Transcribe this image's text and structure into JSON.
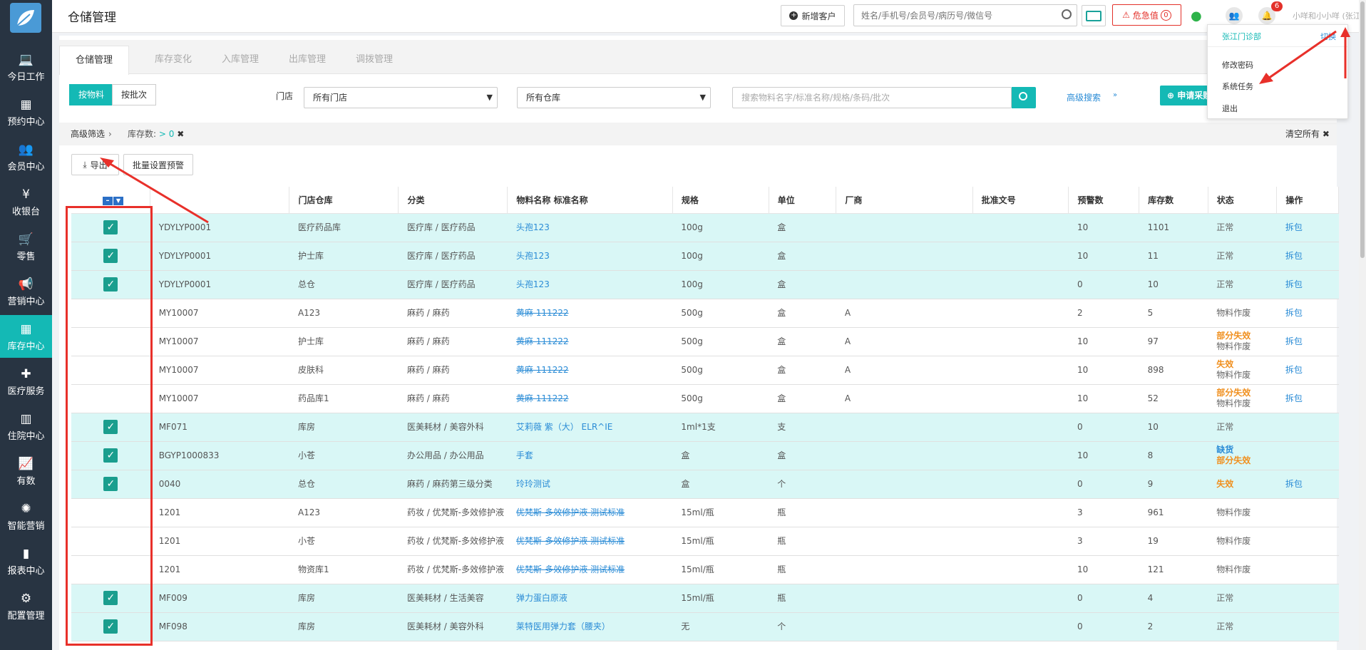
{
  "app": {
    "title": "仓储管理"
  },
  "sidebar": {
    "items": [
      {
        "label": "今日工作",
        "icon": "laptop-icon"
      },
      {
        "label": "预约中心",
        "icon": "calendar-icon"
      },
      {
        "label": "会员中心",
        "icon": "users-icon"
      },
      {
        "label": "收银台",
        "icon": "yen-icon"
      },
      {
        "label": "零售",
        "icon": "cart-icon"
      },
      {
        "label": "营销中心",
        "icon": "megaphone-icon"
      },
      {
        "label": "库存中心",
        "icon": "grid-icon"
      },
      {
        "label": "医疗服务",
        "icon": "medkit-icon"
      },
      {
        "label": "住院中心",
        "icon": "hospital-icon"
      },
      {
        "label": "有数",
        "icon": "line-chart-icon"
      },
      {
        "label": "智能营销",
        "icon": "smart-icon"
      },
      {
        "label": "报表中心",
        "icon": "bar-chart-icon"
      },
      {
        "label": "配置管理",
        "icon": "gear-icon"
      }
    ]
  },
  "header": {
    "new_customer": "新增客户",
    "search_placeholder": "姓名/手机号/会员号/病历号/微信号",
    "danger": "危急值",
    "danger_count": "0",
    "bell_badge": "6",
    "user": "小咩和小小咩 (张江门诊部)"
  },
  "dropdown": {
    "clinic": "张江门诊部",
    "switch": "切换",
    "items": [
      "修改密码",
      "系统任务",
      "退出"
    ]
  },
  "tabs": [
    "仓储管理",
    "库存变化",
    "入库管理",
    "出库管理",
    "调拨管理"
  ],
  "toolbar": {
    "by_material": "按物料",
    "by_batch": "按批次",
    "store_label": "门店",
    "store_value": "所有门店",
    "warehouse_value": "所有仓库",
    "search_placeholder": "搜索物料名字/标准名称/规格/条码/批次",
    "advanced": "高级搜索",
    "apply": "申请采购"
  },
  "filter": {
    "label": "高级筛选",
    "chip_key": "库存数:",
    "chip_val": "> 0",
    "clear": "清空所有"
  },
  "actions": {
    "export": "导出",
    "batch_alert": "批量设置预警"
  },
  "table": {
    "columns": [
      "门店仓库",
      "分类",
      "物料名称 标准名称",
      "规格",
      "单位",
      "厂商",
      "批准文号",
      "预警数",
      "库存数",
      "状态",
      "操作"
    ],
    "rows": [
      {
        "checked": true,
        "code": "YDYLYP0001",
        "wh": "医疗药品库",
        "cat": "医疗库 / 医疗药品",
        "name": "头孢123",
        "style": "link",
        "spec": "100g",
        "unit": "盒",
        "maker": "",
        "alert": "10",
        "stock": "1101",
        "status": [
          "正常"
        ],
        "status_cls": [
          "grey-s"
        ],
        "op": "拆包"
      },
      {
        "checked": true,
        "code": "YDYLYP0001",
        "wh": "护士库",
        "cat": "医疗库 / 医疗药品",
        "name": "头孢123",
        "style": "link",
        "spec": "100g",
        "unit": "盒",
        "maker": "",
        "alert": "10",
        "stock": "11",
        "status": [
          "正常"
        ],
        "status_cls": [
          "grey-s"
        ],
        "op": "拆包"
      },
      {
        "checked": true,
        "code": "YDYLYP0001",
        "wh": "总仓",
        "cat": "医疗库 / 医疗药品",
        "name": "头孢123",
        "style": "link",
        "spec": "100g",
        "unit": "盒",
        "maker": "",
        "alert": "0",
        "stock": "10",
        "status": [
          "正常"
        ],
        "status_cls": [
          "grey-s"
        ],
        "op": "拆包"
      },
      {
        "checked": false,
        "code": "MY10007",
        "wh": "A123",
        "cat": "麻药 / 麻药",
        "name": "黄麻 111222",
        "style": "strike",
        "spec": "500g",
        "unit": "盒",
        "maker": "A",
        "alert": "2",
        "stock": "5",
        "status": [
          "物料作废"
        ],
        "status_cls": [
          "grey-s"
        ],
        "op": "拆包"
      },
      {
        "checked": false,
        "code": "MY10007",
        "wh": "护士库",
        "cat": "麻药 / 麻药",
        "name": "黄麻 111222",
        "style": "strike",
        "spec": "500g",
        "unit": "盒",
        "maker": "A",
        "alert": "10",
        "stock": "97",
        "status": [
          "部分失效",
          "物料作废"
        ],
        "status_cls": [
          "orange",
          "grey-s"
        ],
        "op": "拆包"
      },
      {
        "checked": false,
        "code": "MY10007",
        "wh": "皮肤科",
        "cat": "麻药 / 麻药",
        "name": "黄麻 111222",
        "style": "strike",
        "spec": "500g",
        "unit": "盒",
        "maker": "A",
        "alert": "10",
        "stock": "898",
        "status": [
          "失效",
          "物料作废"
        ],
        "status_cls": [
          "orange",
          "grey-s"
        ],
        "op": "拆包"
      },
      {
        "checked": false,
        "code": "MY10007",
        "wh": "药品库1",
        "cat": "麻药 / 麻药",
        "name": "黄麻 111222",
        "style": "strike",
        "spec": "500g",
        "unit": "盒",
        "maker": "A",
        "alert": "10",
        "stock": "52",
        "status": [
          "部分失效",
          "物料作废"
        ],
        "status_cls": [
          "orange",
          "grey-s"
        ],
        "op": "拆包"
      },
      {
        "checked": true,
        "code": "MF071",
        "wh": "库房",
        "cat": "医美耗材 / 美容外科",
        "name": "艾莉薇 紫（大） ELR^IE",
        "style": "link",
        "spec": "1ml*1支",
        "unit": "支",
        "maker": "",
        "alert": "0",
        "stock": "10",
        "status": [
          "正常"
        ],
        "status_cls": [
          "grey-s"
        ],
        "op": ""
      },
      {
        "checked": true,
        "code": "BGYP1000833",
        "wh": "小苍",
        "cat": "办公用品 / 办公用品",
        "name": "手套",
        "style": "link",
        "spec": "盒",
        "unit": "盒",
        "maker": "",
        "alert": "10",
        "stock": "8",
        "status": [
          "缺货",
          "部分失效"
        ],
        "status_cls": [
          "blue-b",
          "orange"
        ],
        "op": ""
      },
      {
        "checked": true,
        "code": "0040",
        "wh": "总仓",
        "cat": "麻药 / 麻药第三级分类",
        "name": "玲玲测试",
        "style": "link",
        "spec": "盒",
        "unit": "个",
        "maker": "",
        "alert": "0",
        "stock": "9",
        "status": [
          "失效"
        ],
        "status_cls": [
          "orange"
        ],
        "op": "拆包"
      },
      {
        "checked": false,
        "code": "1201",
        "wh": "A123",
        "cat": "药妆 / 优梵斯-多效修护液",
        "name": "优梵斯-多效修护液 测试标准",
        "style": "strike",
        "spec": "15ml/瓶",
        "unit": "瓶",
        "maker": "",
        "alert": "3",
        "stock": "961",
        "status": [
          "物料作废"
        ],
        "status_cls": [
          "grey-s"
        ],
        "op": ""
      },
      {
        "checked": false,
        "code": "1201",
        "wh": "小苍",
        "cat": "药妆 / 优梵斯-多效修护液",
        "name": "优梵斯-多效修护液 测试标准",
        "style": "strike",
        "spec": "15ml/瓶",
        "unit": "瓶",
        "maker": "",
        "alert": "3",
        "stock": "19",
        "status": [
          "物料作废"
        ],
        "status_cls": [
          "grey-s"
        ],
        "op": ""
      },
      {
        "checked": false,
        "code": "1201",
        "wh": "物资库1",
        "cat": "药妆 / 优梵斯-多效修护液",
        "name": "优梵斯-多效修护液 测试标准",
        "style": "strike",
        "spec": "15ml/瓶",
        "unit": "瓶",
        "maker": "",
        "alert": "10",
        "stock": "121",
        "status": [
          "物料作废"
        ],
        "status_cls": [
          "grey-s"
        ],
        "op": ""
      },
      {
        "checked": true,
        "code": "MF009",
        "wh": "库房",
        "cat": "医美耗材 / 生活美容",
        "name": "弹力蛋白原液",
        "style": "link",
        "spec": "15ml/瓶",
        "unit": "瓶",
        "maker": "",
        "alert": "0",
        "stock": "4",
        "status": [
          "正常"
        ],
        "status_cls": [
          "grey-s"
        ],
        "op": ""
      },
      {
        "checked": true,
        "code": "MF098",
        "wh": "库房",
        "cat": "医美耗材 / 美容外科",
        "name": "莱特医用弹力套（腰夹）",
        "style": "link",
        "spec": "无",
        "unit": "个",
        "maker": "",
        "alert": "0",
        "stock": "2",
        "status": [
          "正常"
        ],
        "status_cls": [
          "grey-s"
        ],
        "op": ""
      }
    ]
  }
}
